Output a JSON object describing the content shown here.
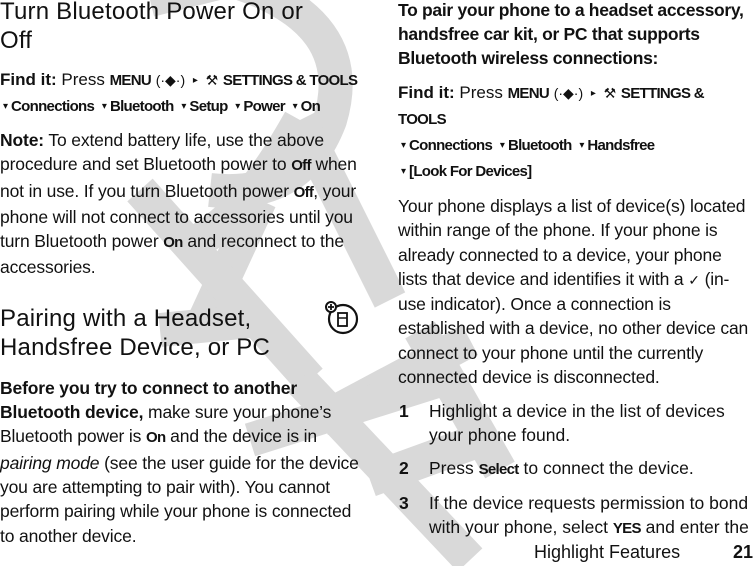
{
  "watermark": {
    "text": "DRAFT",
    "color": "#d9d9d9"
  },
  "left": {
    "section1": {
      "title": "Turn Bluetooth Power On or Off",
      "title_line1": "Turn Bluetooth Power On or",
      "title_line2": "Off",
      "find_it": {
        "label": "Find it:",
        "press": "Press",
        "menu_key": "MENU",
        "nav_icon": "nav-key-icon",
        "settings_icon": "settings-tools-icon",
        "settings_label": "SETTINGS & TOOLS",
        "path": [
          "Connections",
          "Bluetooth",
          "Setup",
          "Power",
          "On"
        ]
      },
      "note": {
        "label": "Note:",
        "text1": "To extend battery life, use the above procedure and set Bluetooth power to",
        "off1": "Off",
        "text2": "when not in use. If you turn Bluetooth power",
        "off2": "Off",
        "text3": ", your phone will not connect to accessories until you turn Bluetooth power",
        "on": "On",
        "text4": "and reconnect to the accessories."
      }
    },
    "section2": {
      "title_line1": "Pairing with a Headset,",
      "title_line2": "Handsfree Device, or PC",
      "icon": "new-feature-phone-icon",
      "para": {
        "bold": "Before you try to connect to another Bluetooth device,",
        "text1": "make sure your phone’s Bluetooth power is",
        "on": "On",
        "text2": "and the device is in",
        "italic": "pairing mode",
        "text3": "(see the user guide for the device you are attempting to pair with). You cannot perform pairing while your phone is connected to another device."
      }
    }
  },
  "right": {
    "intro_bold": "To pair your phone to a headset accessory, handsfree car kit, or PC that supports Bluetooth wireless connections:",
    "find_it": {
      "label": "Find it:",
      "press": "Press",
      "menu_key": "MENU",
      "settings_label": "SETTINGS & TOOLS",
      "path": [
        "Connections",
        "Bluetooth",
        "Handsfree",
        "[Look For Devices]"
      ]
    },
    "para": {
      "text1": "Your phone displays a list of device(s) located within range of the phone. If your phone is already connected to a device, your phone lists that device and identifies it with a",
      "check_icon": "in-use-check-icon",
      "text2": "(in-use indicator). Once a connection is established with a device, no other device can connect to your phone until the currently connected device is disconnected."
    },
    "steps": [
      {
        "num": "1",
        "text": "Highlight a device in the list of devices your phone found."
      },
      {
        "num": "2",
        "pre": "Press",
        "key": "Select",
        "post": "to connect the device."
      },
      {
        "num": "3",
        "pre": "If the device requests permission to bond with your phone, select",
        "key": "YES",
        "post": "and enter the"
      }
    ]
  },
  "footer": {
    "section": "Highlight Features",
    "page": "21"
  }
}
